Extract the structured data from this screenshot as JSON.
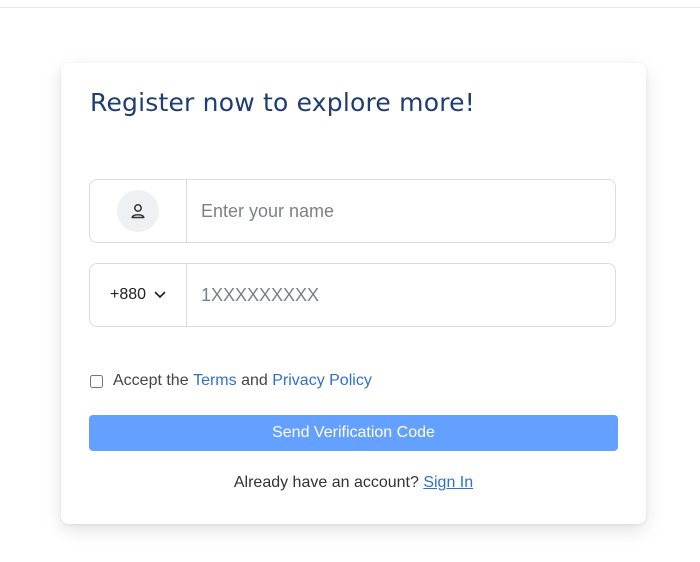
{
  "form": {
    "title": "Register now to explore more!",
    "name_field": {
      "placeholder": "Enter your name",
      "value": "",
      "icon": "user-icon"
    },
    "phone_field": {
      "country_code": "+880",
      "placeholder": "1XXXXXXXXX",
      "value": "",
      "dropdown_icon": "chevron-down-icon"
    },
    "terms": {
      "checked": false,
      "prefix": "Accept the",
      "terms_link": "Terms",
      "conjunction": "and",
      "privacy_link": "Privacy Policy"
    },
    "submit_label": "Send Verification Code",
    "signin": {
      "prompt": "Already have an account?",
      "link": "Sign In"
    }
  },
  "colors": {
    "title": "#1e3d73",
    "primary_button": "#64a0ff",
    "link": "#2f6fd0"
  }
}
